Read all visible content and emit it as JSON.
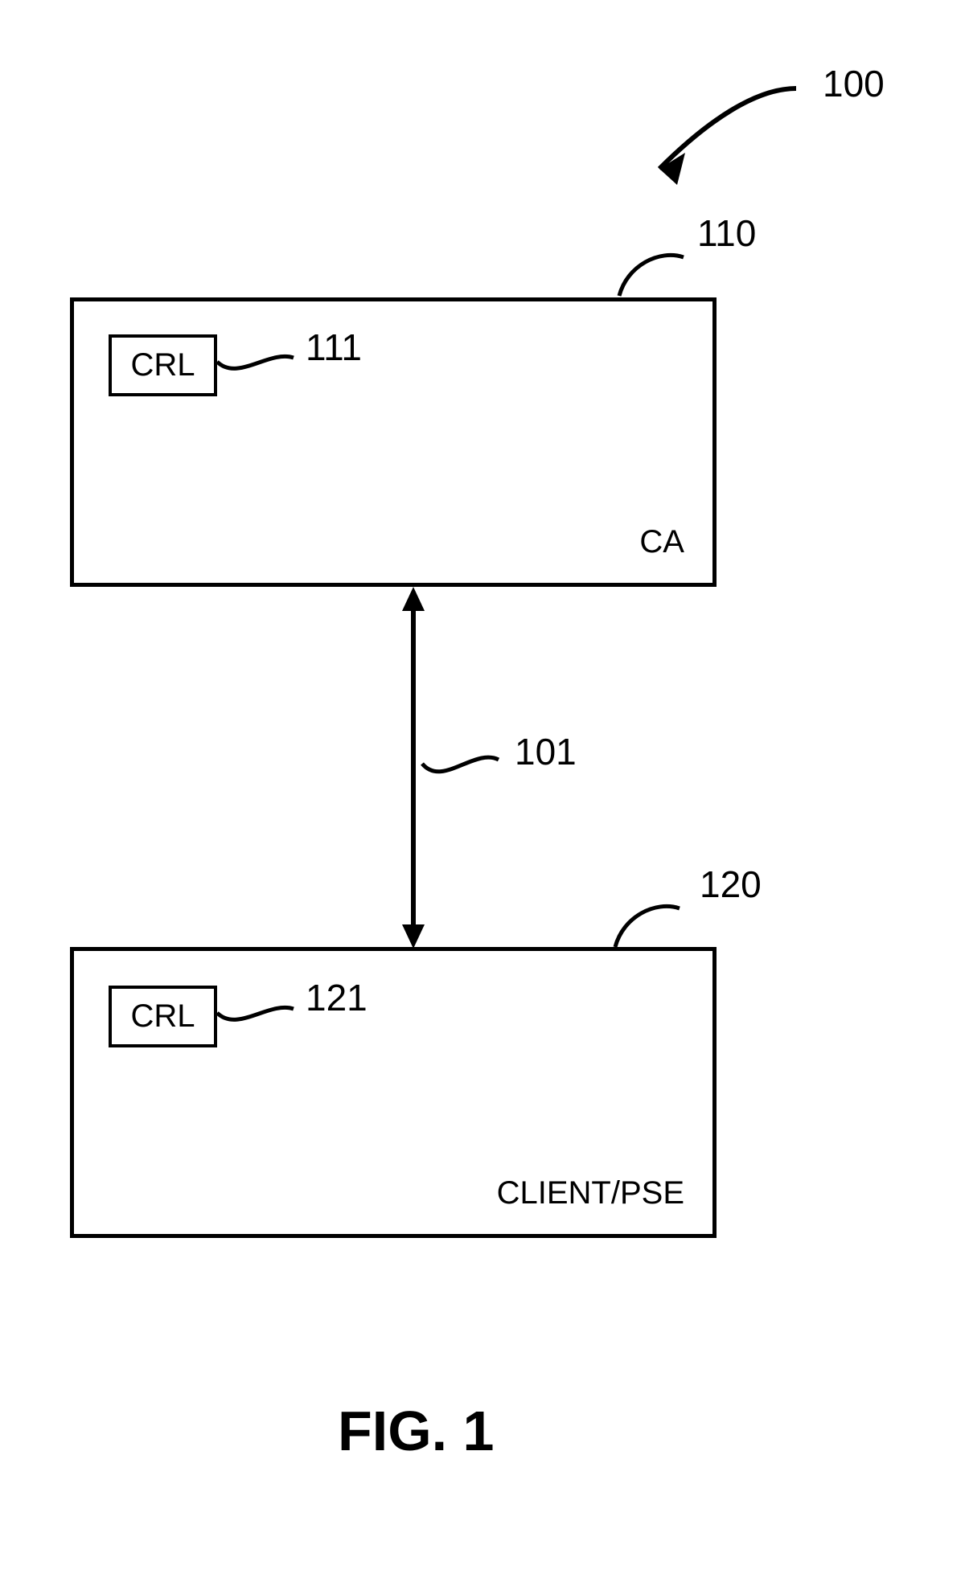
{
  "labels": {
    "system_ref": "100",
    "top_box_ref": "110",
    "top_crl_ref": "111",
    "connector_ref": "101",
    "bottom_box_ref": "120",
    "bottom_crl_ref": "121",
    "top_box_corner": "CA",
    "bottom_box_corner": "CLIENT/PSE",
    "crl_text": "CRL"
  },
  "caption": "FIG. 1"
}
